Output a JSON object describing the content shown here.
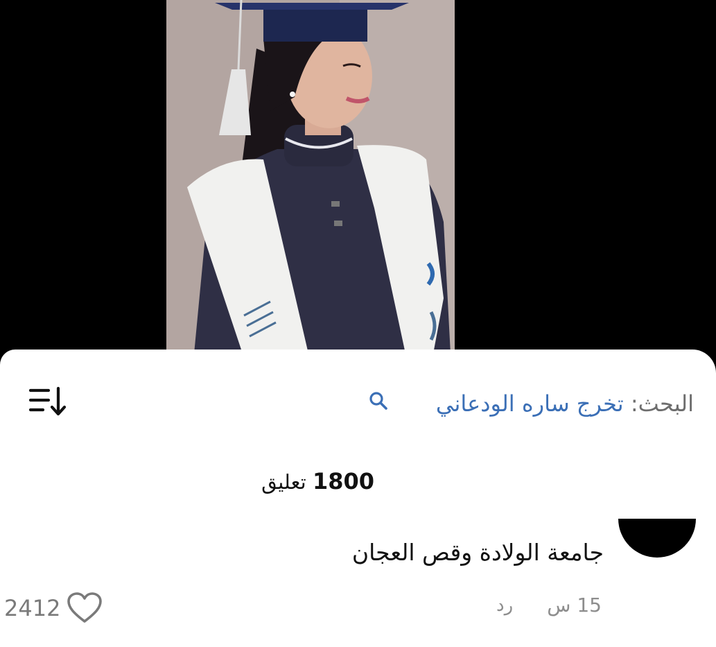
{
  "search": {
    "prefix": "البحث:",
    "query": "تخرج ساره الودعاني",
    "icon": "search-icon"
  },
  "sort": {
    "icon": "sort-list-icon"
  },
  "comments": {
    "count": "1800",
    "label": "تعليق"
  },
  "comment": {
    "text": "جامعة الولادة وقص العجان",
    "time": "15 س",
    "reply_label": "رد",
    "likes": "2412"
  },
  "colors": {
    "search_query": "#3b6fb6",
    "meta_gray": "#8d8d8d",
    "background": "#ffffff"
  }
}
